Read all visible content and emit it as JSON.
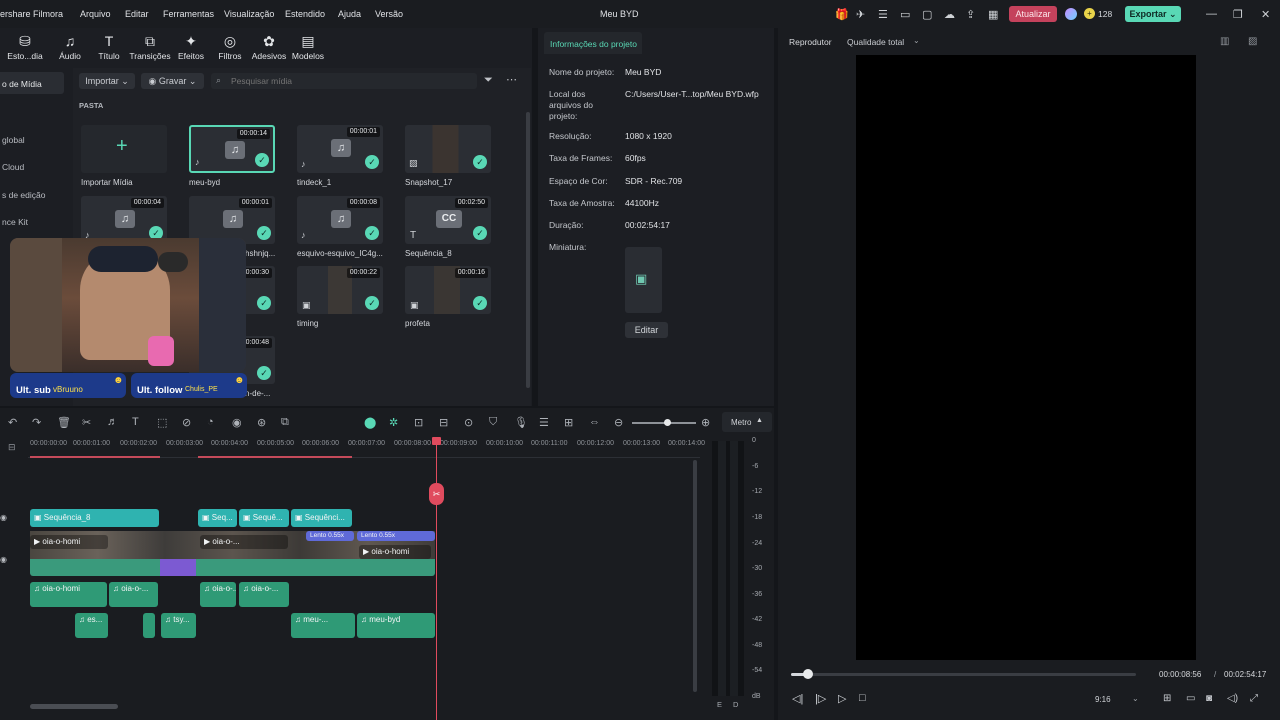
{
  "app": {
    "title_partial": "ershare Filmora",
    "project_name": "Meu BYD",
    "menu": [
      "Arquivo",
      "Editar",
      "Ferramentas",
      "Visualização",
      "Estendido",
      "Ajuda",
      "Versão"
    ],
    "upgrade_label": "Atualizar",
    "credits": "128",
    "export_label": "Exportar"
  },
  "toolbar": {
    "items": [
      "Esto...dia",
      "Áudio",
      "Título",
      "Transições",
      "Efeitos",
      "Filtros",
      "Adesivos",
      "Modelos"
    ]
  },
  "sidebar": {
    "items": [
      "o de Mídia",
      "global",
      "Cloud",
      "s de edição",
      "nce Kit"
    ]
  },
  "media": {
    "import_label": "Importar",
    "record_label": "Gravar",
    "search_placeholder": "Pesquisar mídia",
    "folder_label": "PASTA",
    "import_media_label": "Importar Mídia",
    "items": [
      {
        "name": "meu-byd",
        "duration": "00:00:14"
      },
      {
        "name": "tindeck_1",
        "duration": "00:00:01"
      },
      {
        "name": "Snapshot_17",
        "duration": ""
      },
      {
        "name": "",
        "duration": "00:00:04"
      },
      {
        "name": "hshnjq...",
        "duration": "00:00:01"
      },
      {
        "name": "esquivo-esquivo_IC4g...",
        "duration": "00:00:08"
      },
      {
        "name": "Sequência_8",
        "duration": "00:02:50"
      },
      {
        "name": "",
        "duration": "00:00:30"
      },
      {
        "name": "timing",
        "duration": "00:00:22"
      },
      {
        "name": "profeta",
        "duration": "00:00:16"
      },
      {
        "name": "n-de-...",
        "duration": "00:00:48"
      }
    ],
    "cc_label": "CC"
  },
  "webcam": {
    "sub_label": "Ult. sub",
    "sub_name": "vBruuno",
    "follow_label": "Ult. follow",
    "follow_name": "Chulis_PE"
  },
  "project_info": {
    "tab": "Informações do projeto",
    "rows": [
      {
        "label": "Nome do projeto:",
        "value": "Meu BYD"
      },
      {
        "label": "Local dos arquivos do projeto:",
        "value": "C:/Users/User-T...top/Meu BYD.wfp"
      },
      {
        "label": "Resolução:",
        "value": "1080 x 1920"
      },
      {
        "label": "Taxa de Frames:",
        "value": "60fps"
      },
      {
        "label": "Espaço de Cor:",
        "value": "SDR - Rec.709"
      },
      {
        "label": "Taxa de Amostra:",
        "value": "44100Hz"
      },
      {
        "label": "Duração:",
        "value": "00:02:54:17"
      },
      {
        "label": "Miniatura:",
        "value": ""
      }
    ],
    "edit_label": "Editar"
  },
  "player": {
    "label": "Reprodutor",
    "quality": "Qualidade total",
    "current_time": "00:00:08:56",
    "total_time": "00:02:54:17",
    "aspect": "9:16",
    "progress": 0.05
  },
  "timeline": {
    "meter_label": "Metro",
    "ruler": [
      "00:00:00:00",
      "00:00:01:00",
      "00:00:02:00",
      "00:00:03:00",
      "00:00:04:00",
      "00:00:05:00",
      "00:00:06:00",
      "00:00:07:00",
      "00:00:08:00",
      "00:00:09:00",
      "00:00:10:00",
      "00:00:11:00",
      "00:00:12:00",
      "00:00:13:00",
      "00:00:14:00"
    ],
    "title_clips": [
      "Sequência_8",
      "Seq...",
      "Sequê...",
      "Sequênci..."
    ],
    "video_clips": [
      "oia-o-homi",
      "oia-o-...",
      "oia-o-homi"
    ],
    "speed_badges": [
      "Lento 0.55x",
      "Lento 0.55x"
    ],
    "audio_clips_1": [
      "oia-o-homi",
      "oia-o-...",
      "oia-o-...",
      "oia-o-..."
    ],
    "audio_clips_2": [
      "es...",
      "tsy...",
      "meu-...",
      "meu-byd"
    ],
    "db_scale": [
      "0",
      "-6",
      "-12",
      "-18",
      "-24",
      "-30",
      "-36",
      "-42",
      "-48",
      "-54",
      "dB"
    ],
    "channels": [
      "E",
      "D"
    ]
  },
  "colors": {
    "accent": "#59d8b5",
    "title_clip": "#2fb3b0",
    "video_clip": "#3a8f78",
    "audio_clip": "#2f9a76",
    "playhead": "#e04b5e",
    "upgrade": "#c4425c"
  }
}
